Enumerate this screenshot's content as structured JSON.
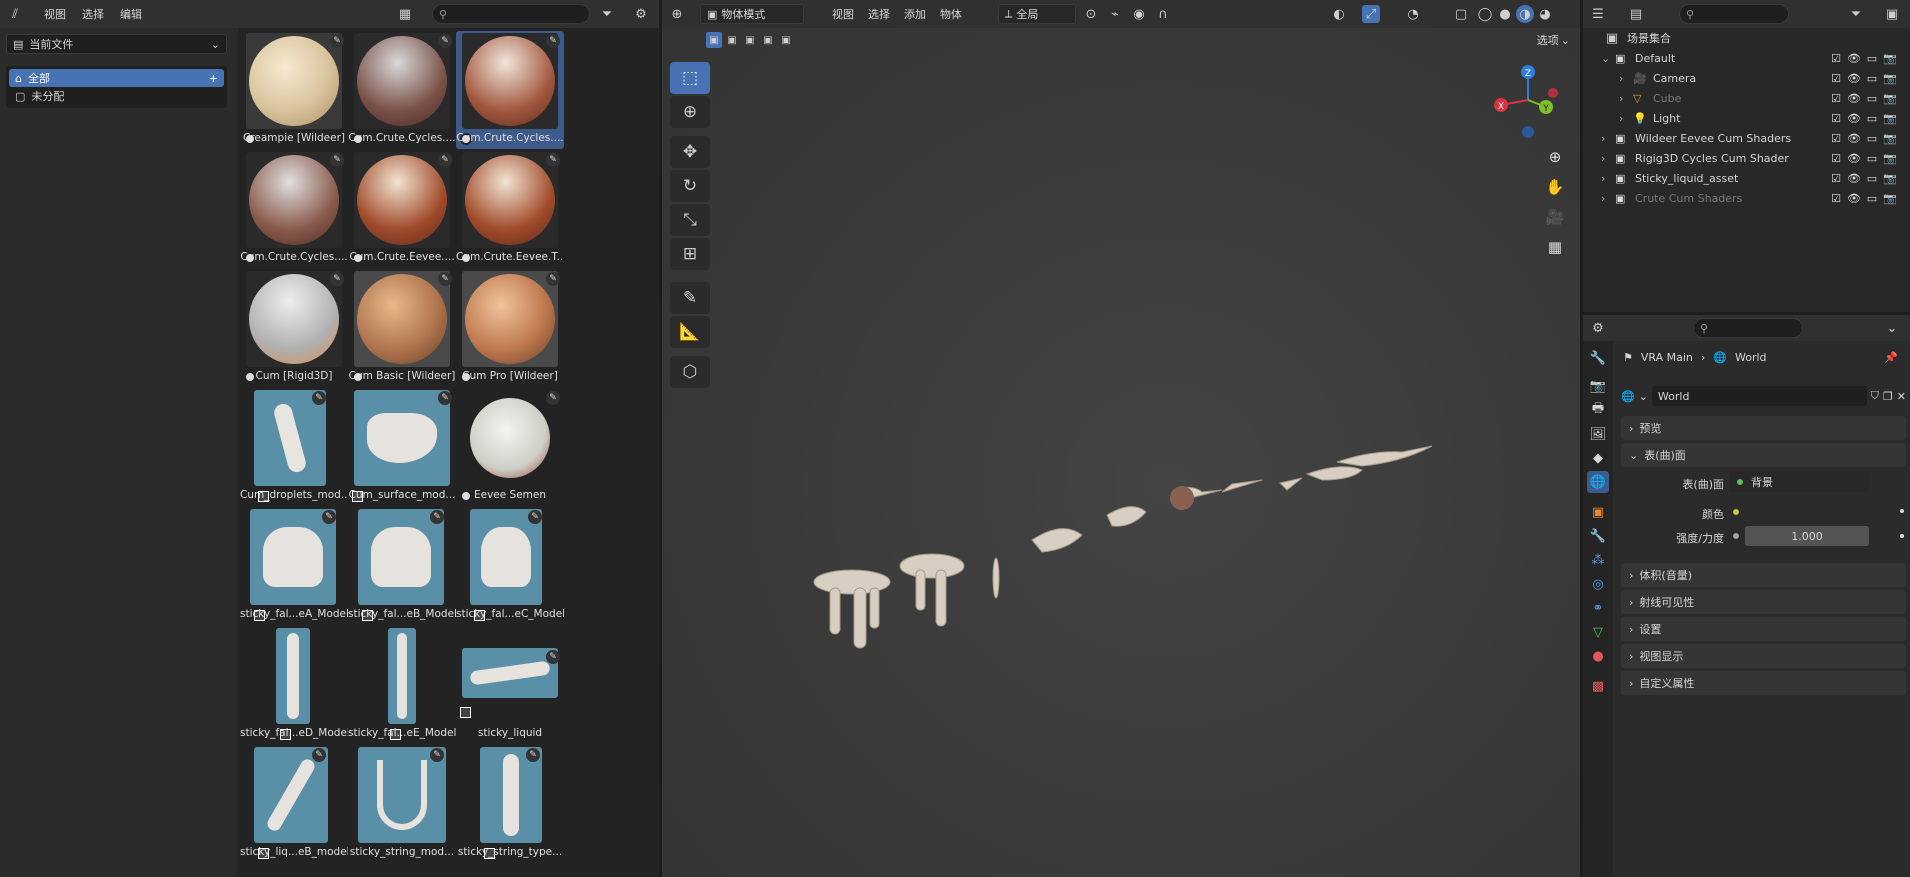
{
  "asset_browser": {
    "menu": [
      "视图",
      "选择",
      "编辑"
    ],
    "library": "当前文件",
    "catalogs": [
      {
        "label": "全部",
        "selected": true
      },
      {
        "label": "未分配",
        "selected": false
      }
    ],
    "assets": [
      {
        "label": "Creampie [Wildeer]",
        "kind": "material",
        "selected": false
      },
      {
        "label": "Cum.Crute.Cycles....",
        "kind": "material",
        "selected": false
      },
      {
        "label": "Cum.Crute.Cycles....",
        "kind": "material",
        "selected": true
      },
      {
        "label": "Cum.Crute.Cycles....",
        "kind": "material",
        "selected": false
      },
      {
        "label": "Cum.Crute.Eevee....",
        "kind": "material",
        "selected": false
      },
      {
        "label": "Cum.Crute.Eevee.T...",
        "kind": "material",
        "selected": false
      },
      {
        "label": "Cum [Rigid3D]",
        "kind": "material",
        "selected": false
      },
      {
        "label": "Cum Basic [Wildeer]",
        "kind": "material",
        "selected": false
      },
      {
        "label": "Cum Pro [Wildeer]",
        "kind": "material",
        "selected": false
      },
      {
        "label": "Cum_droplets_mod...",
        "kind": "object",
        "selected": false
      },
      {
        "label": "Cum_surface_mod...",
        "kind": "object",
        "selected": false
      },
      {
        "label": "Eevee Semen",
        "kind": "material",
        "selected": false
      },
      {
        "label": "sticky_fal...eA_Model",
        "kind": "object",
        "selected": false
      },
      {
        "label": "sticky_fal...eB_Model",
        "kind": "object",
        "selected": false
      },
      {
        "label": "sticky_fal...eC_Model",
        "kind": "object",
        "selected": false
      },
      {
        "label": "sticky_fal...eD_Model",
        "kind": "object",
        "selected": false
      },
      {
        "label": "sticky_fal...eE_Model",
        "kind": "object",
        "selected": false
      },
      {
        "label": "sticky_liquid",
        "kind": "object",
        "selected": false
      },
      {
        "label": "sticky_liq...eB_model",
        "kind": "object",
        "selected": false
      },
      {
        "label": "sticky_string_mod...",
        "kind": "object",
        "selected": false
      },
      {
        "label": "sticky_string_type...",
        "kind": "object",
        "selected": false
      }
    ]
  },
  "viewport": {
    "mode": "物体模式",
    "menu": [
      "视图",
      "选择",
      "添加",
      "物体"
    ],
    "orientation": "全局",
    "options": "选项",
    "axes": {
      "x": "X",
      "y": "Y",
      "z": "Z"
    }
  },
  "outliner": {
    "title": "场景集合",
    "rows": [
      {
        "label": "Default",
        "indent": 0,
        "type": "collection"
      },
      {
        "label": "Camera",
        "indent": 1,
        "type": "camera"
      },
      {
        "label": "Cube",
        "indent": 1,
        "type": "mesh",
        "dim": true
      },
      {
        "label": "Light",
        "indent": 1,
        "type": "light"
      },
      {
        "label": "Wildeer Eevee Cum Shaders",
        "indent": 0,
        "type": "collection"
      },
      {
        "label": "Rigig3D Cycles Cum Shader",
        "indent": 0,
        "type": "collection"
      },
      {
        "label": "Sticky_liquid_asset",
        "indent": 0,
        "type": "collection"
      },
      {
        "label": "Crute Cum Shaders",
        "indent": 0,
        "type": "collection",
        "dim": true
      }
    ]
  },
  "properties": {
    "breadcrumb": [
      "VRA Main",
      "World"
    ],
    "datablock": "World",
    "panels": {
      "preview": "预览",
      "surface": "表(曲)面",
      "volume": "体积(音量)",
      "ray_visibility": "射线可见性",
      "settings": "设置",
      "viewport_display": "视图显示",
      "custom_props": "自定义属性"
    },
    "surface_label": "表(曲)面",
    "surface_value": "背景",
    "color_label": "颜色",
    "strength_label": "强度/力度",
    "strength_value": "1.000"
  },
  "colors": {
    "accent": "#4772b3",
    "header": "#303030",
    "panel": "#282828"
  }
}
